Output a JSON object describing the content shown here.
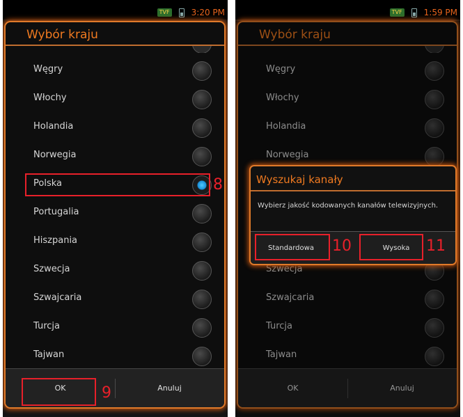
{
  "left_screen": {
    "status": {
      "tv_badge": "TVF",
      "time": "3:20 PM"
    },
    "dialog_title": "Wybór kraju",
    "countries": [
      {
        "label": "Węgry",
        "checked": false
      },
      {
        "label": "Włochy",
        "checked": false
      },
      {
        "label": "Holandia",
        "checked": false
      },
      {
        "label": "Norwegia",
        "checked": false
      },
      {
        "label": "Polska",
        "checked": true
      },
      {
        "label": "Portugalia",
        "checked": false
      },
      {
        "label": "Hiszpania",
        "checked": false
      },
      {
        "label": "Szwecja",
        "checked": false
      },
      {
        "label": "Szwajcaria",
        "checked": false
      },
      {
        "label": "Turcja",
        "checked": false
      },
      {
        "label": "Tajwan",
        "checked": false
      }
    ],
    "ok_label": "OK",
    "cancel_label": "Anuluj",
    "annotations": {
      "selected_country": "8",
      "ok_button": "9"
    }
  },
  "right_screen": {
    "status": {
      "tv_badge": "TVF",
      "time": "1:59 PM"
    },
    "dialog_title": "Wybór kraju",
    "countries": [
      {
        "label": "Węgry"
      },
      {
        "label": "Włochy"
      },
      {
        "label": "Holandia"
      },
      {
        "label": "Norwegia"
      },
      {
        "label": "Szwecja"
      },
      {
        "label": "Szwajcaria"
      },
      {
        "label": "Turcja"
      },
      {
        "label": "Tajwan"
      }
    ],
    "ok_label": "OK",
    "cancel_label": "Anuluj",
    "popup": {
      "title": "Wyszukaj kanały",
      "message": "Wybierz jakość kodowanych kanałów telewizyjnych.",
      "standard_label": "Standardowa",
      "high_label": "Wysoka"
    },
    "annotations": {
      "standard_button": "10",
      "high_button": "11"
    }
  },
  "colors": {
    "accent": "#f07a20",
    "annotation": "#e8202a",
    "selected_radio": "#1a8fd8"
  }
}
